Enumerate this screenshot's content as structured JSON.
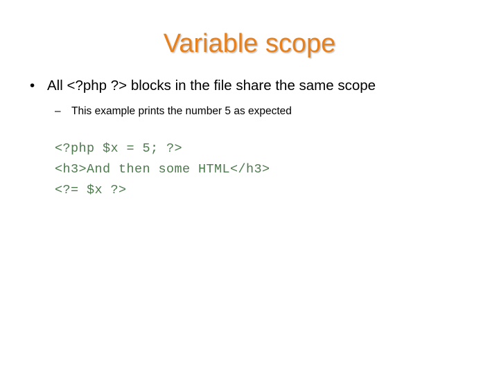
{
  "slide": {
    "title": "Variable scope",
    "title_color": "#E8801C",
    "background_color": "#FFFFFF",
    "body_text_color": "#000000",
    "code_color": "#4E7B4E"
  },
  "bullets": [
    {
      "level": 1,
      "marker": "•",
      "text": "All <?php ?> blocks in the file share the same scope"
    },
    {
      "level": 2,
      "marker": "–",
      "text": "This example prints the number 5 as expected"
    }
  ],
  "code": {
    "lines": [
      "<?php $x = 5; ?>",
      "<h3>And then some HTML</h3>",
      "<?= $x ?>"
    ]
  }
}
